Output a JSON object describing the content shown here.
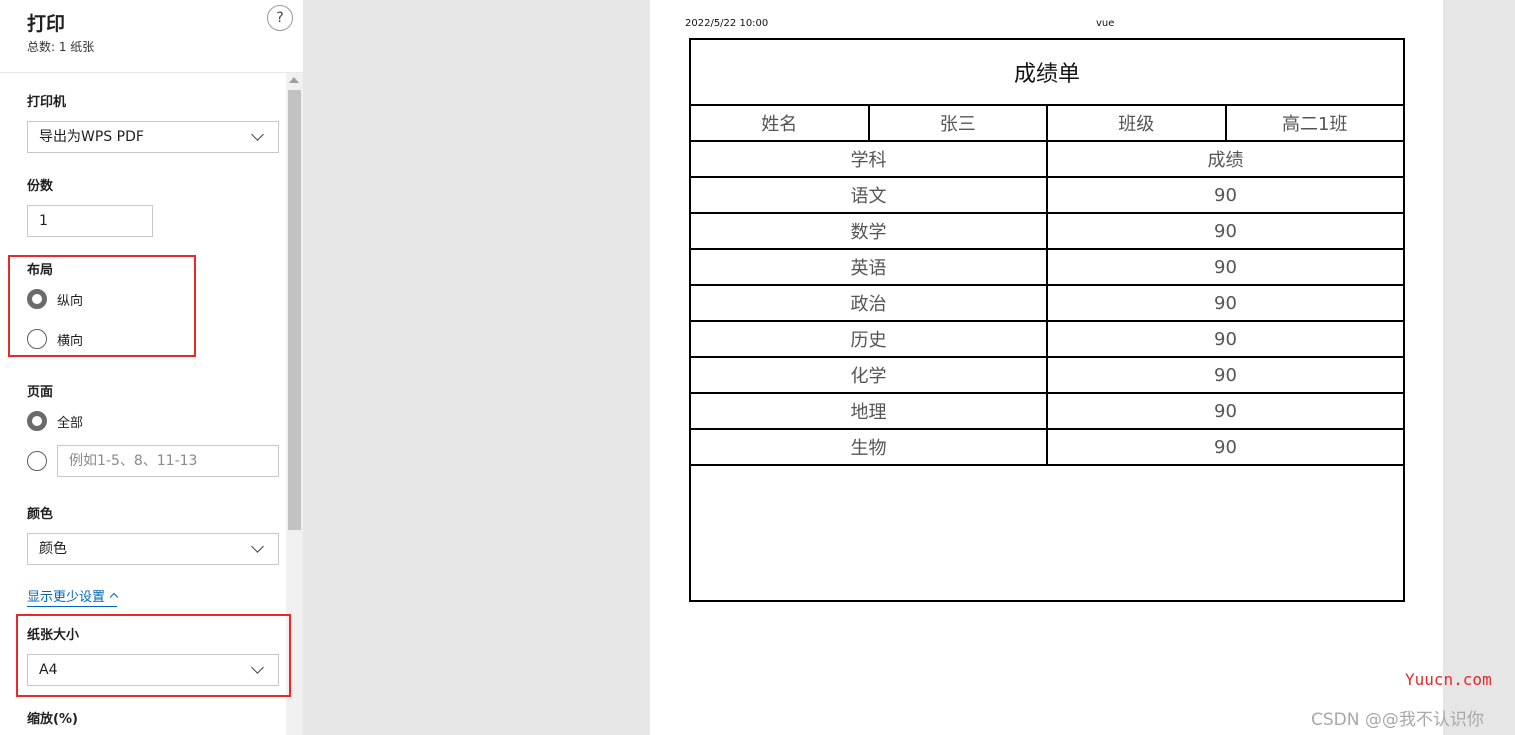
{
  "panel": {
    "title": "打印",
    "subtitle": "总数: 1 纸张",
    "help_label": "?",
    "printer": {
      "label": "打印机",
      "value": "导出为WPS PDF"
    },
    "copies": {
      "label": "份数",
      "value": "1"
    },
    "layout": {
      "label": "布局",
      "options": [
        "纵向",
        "横向"
      ],
      "selected": "纵向"
    },
    "pages": {
      "label": "页面",
      "all_label": "全部",
      "custom_placeholder": "例如1-5、8、11-13",
      "selected": "全部"
    },
    "color": {
      "label": "颜色",
      "value": "颜色"
    },
    "toggle_link": "显示更少设置",
    "paper_size": {
      "label": "纸张大小",
      "value": "A4"
    },
    "scale": {
      "label": "缩放(%)"
    },
    "highlight_color": "#e8292a"
  },
  "preview": {
    "header_date": "2022/5/22 10:00",
    "header_title": "vue",
    "table": {
      "title": "成绩单",
      "info": [
        "姓名",
        "张三",
        "班级",
        "高二1班"
      ],
      "headers": [
        "学科",
        "成绩"
      ],
      "rows": [
        [
          "语文",
          "90"
        ],
        [
          "数学",
          "90"
        ],
        [
          "英语",
          "90"
        ],
        [
          "政治",
          "90"
        ],
        [
          "历史",
          "90"
        ],
        [
          "化学",
          "90"
        ],
        [
          "地理",
          "90"
        ],
        [
          "生物",
          "90"
        ]
      ]
    }
  },
  "watermark": {
    "site": "Yuucn.com",
    "author": "CSDN @@我不认识你"
  }
}
